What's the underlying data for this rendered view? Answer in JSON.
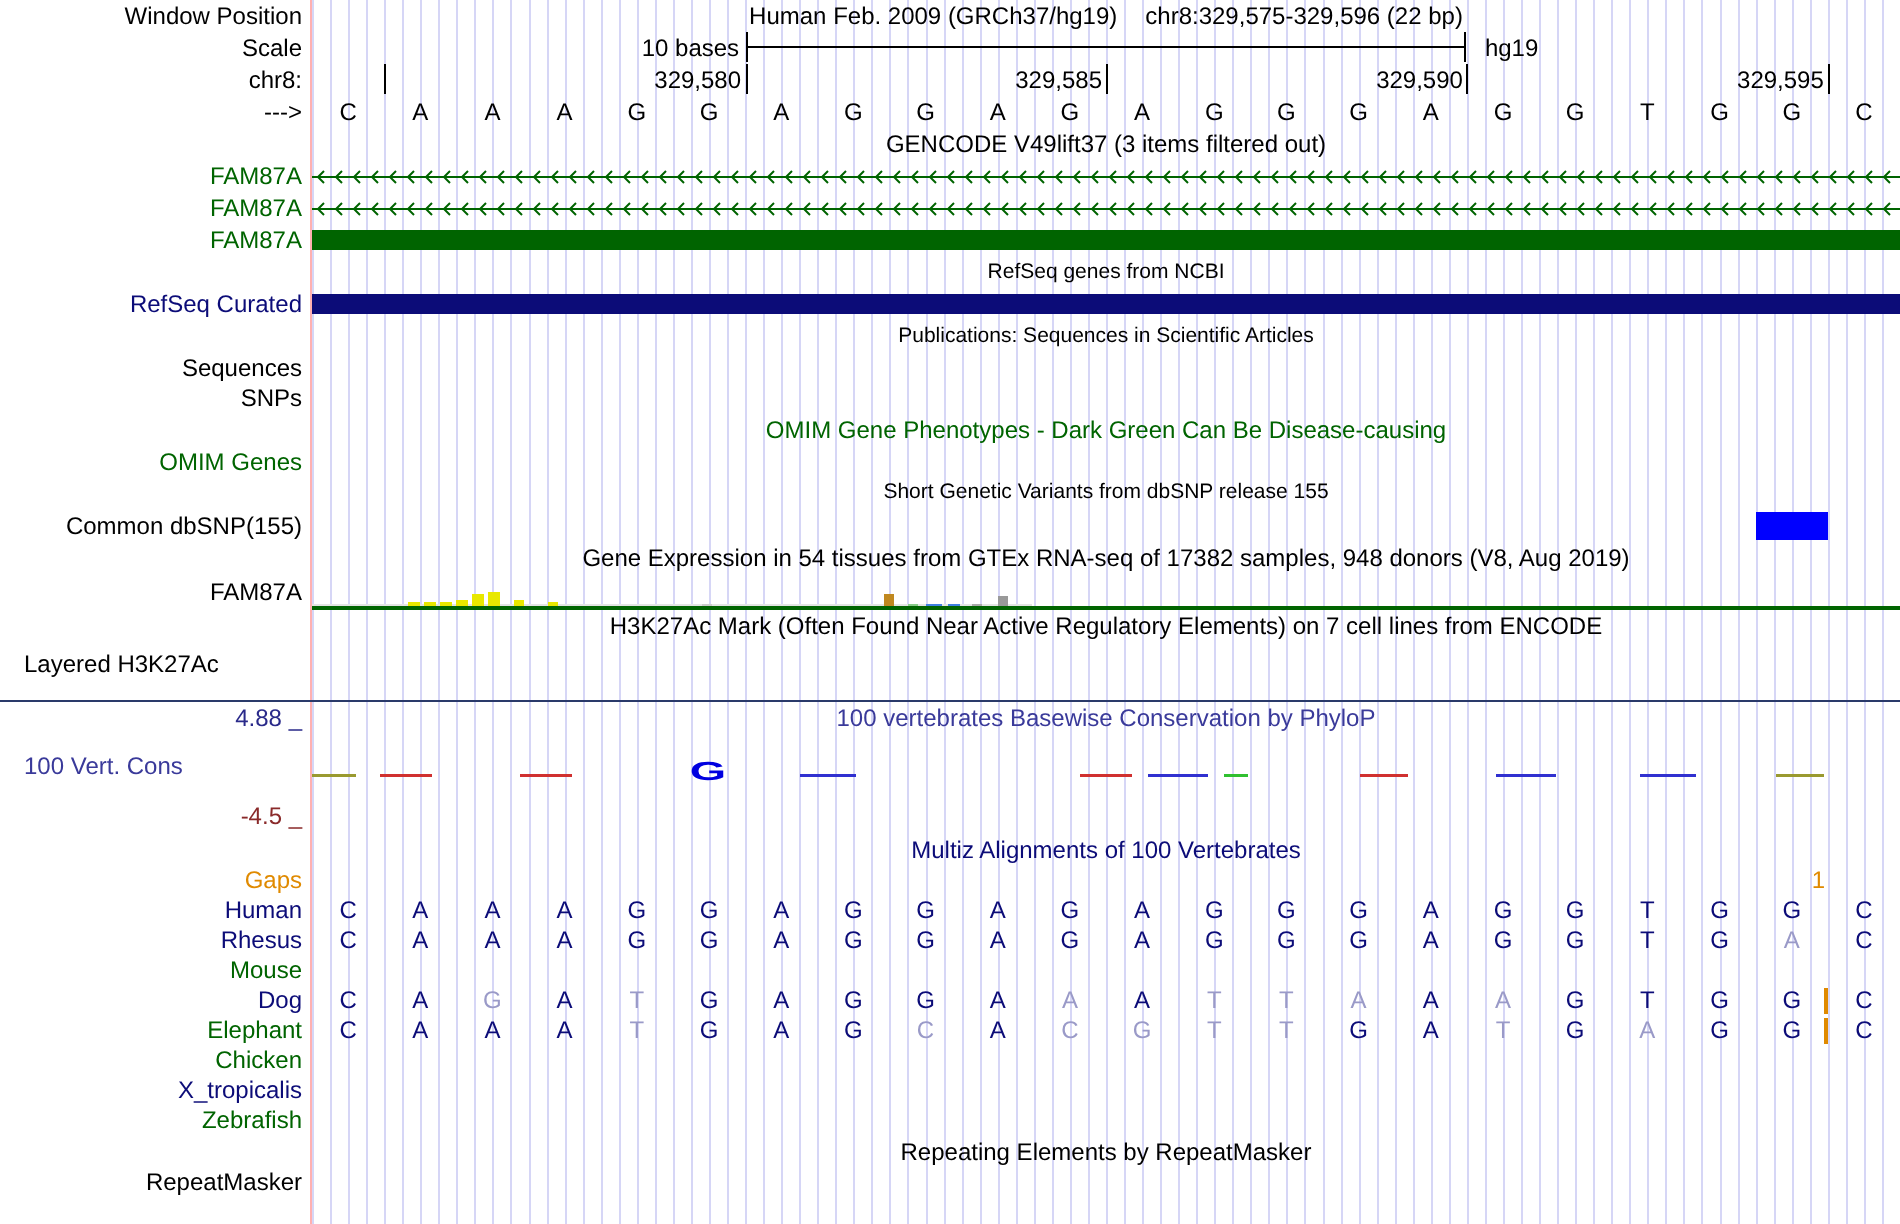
{
  "header": {
    "position_label": "Window Position",
    "assembly": "Human Feb. 2009 (GRCh37/hg19)",
    "range": "chr8:329,575-329,596 (22 bp)",
    "scale_label": "Scale",
    "scale_text": "10 bases",
    "scale_db": "hg19",
    "chrom_label": "chr8:",
    "ticks": [
      "329,580",
      "329,585",
      "329,590",
      "329,595"
    ],
    "strand_label": "--->",
    "bases": [
      "C",
      "A",
      "A",
      "A",
      "G",
      "G",
      "A",
      "G",
      "G",
      "A",
      "G",
      "A",
      "G",
      "G",
      "G",
      "A",
      "G",
      "G",
      "T",
      "G",
      "G",
      "C"
    ]
  },
  "tracks": [
    {
      "kind": "title",
      "text": "GENCODE V49lift37 (3 items filtered out)",
      "color": "#000000"
    },
    {
      "kind": "gene_arrows",
      "label": "FAM87A",
      "color": "#006400"
    },
    {
      "kind": "gene_arrows",
      "label": "FAM87A",
      "color": "#006400"
    },
    {
      "kind": "gene_block",
      "label": "FAM87A",
      "color": "#006400"
    },
    {
      "kind": "note",
      "text": "RefSeq genes from NCBI",
      "color": "#000000"
    },
    {
      "kind": "gene_block",
      "label": "RefSeq Curated",
      "color": "#0c0c78"
    },
    {
      "kind": "note",
      "text": "Publications: Sequences in Scientific Articles",
      "color": "#000000"
    },
    {
      "kind": "label",
      "label": "Sequences",
      "color": "#000000"
    },
    {
      "kind": "label",
      "label": "SNPs",
      "color": "#000000"
    },
    {
      "kind": "title",
      "text": "OMIM Gene Phenotypes - Dark Green Can Be Disease-causing",
      "color": "#006400"
    },
    {
      "kind": "label",
      "label": "OMIM Genes",
      "color": "#006400"
    },
    {
      "kind": "note",
      "text": "Short Genetic Variants from dbSNP release 155",
      "color": "#000000"
    },
    {
      "kind": "snp",
      "label": "Common dbSNP(155)",
      "color": "#000000"
    },
    {
      "kind": "title",
      "text": "Gene Expression in 54 tissues from GTEx RNA-seq of 17382 samples, 948 donors (V8, Aug 2019)",
      "color": "#000000"
    },
    {
      "kind": "expression",
      "label": "FAM87A",
      "color": "#000000"
    },
    {
      "kind": "title",
      "text": "H3K27Ac Mark (Often Found Near Active Regulatory Elements) on 7 cell lines from ENCODE",
      "color": "#000000"
    },
    {
      "kind": "layered",
      "label": "Layered H3K27Ac",
      "color": "#000000"
    },
    {
      "kind": "phylop",
      "title": "100 vertebrates Basewise Conservation by PhyloP",
      "label": "100 Vert. Cons",
      "max": "4.88 _",
      "min": "-4.5 _",
      "letter": "G",
      "color": "#3a3a9a"
    },
    {
      "kind": "title",
      "text": "Multiz Alignments of 100 Vertebrates",
      "color": "#0c0c78"
    },
    {
      "kind": "gaps",
      "label": "Gaps",
      "count": "1",
      "color": "#e08a00"
    },
    {
      "kind": "species",
      "label": "Human",
      "color": "#0c0c78",
      "bases": [
        {
          "b": "C",
          "match": true
        },
        {
          "b": "A",
          "match": true
        },
        {
          "b": "A",
          "match": true
        },
        {
          "b": "A",
          "match": true
        },
        {
          "b": "G",
          "match": true
        },
        {
          "b": "G",
          "match": true
        },
        {
          "b": "A",
          "match": true
        },
        {
          "b": "G",
          "match": true
        },
        {
          "b": "G",
          "match": true
        },
        {
          "b": "A",
          "match": true
        },
        {
          "b": "G",
          "match": true
        },
        {
          "b": "A",
          "match": true
        },
        {
          "b": "G",
          "match": true
        },
        {
          "b": "G",
          "match": true
        },
        {
          "b": "G",
          "match": true
        },
        {
          "b": "A",
          "match": true
        },
        {
          "b": "G",
          "match": true
        },
        {
          "b": "G",
          "match": true
        },
        {
          "b": "T",
          "match": true
        },
        {
          "b": "G",
          "match": true
        },
        {
          "b": "G",
          "match": true
        },
        {
          "b": "C",
          "match": true
        }
      ]
    },
    {
      "kind": "species",
      "label": "Rhesus",
      "color": "#0c0c78",
      "bases": [
        {
          "b": "C",
          "match": true
        },
        {
          "b": "A",
          "match": true
        },
        {
          "b": "A",
          "match": true
        },
        {
          "b": "A",
          "match": true
        },
        {
          "b": "G",
          "match": true
        },
        {
          "b": "G",
          "match": true
        },
        {
          "b": "A",
          "match": true
        },
        {
          "b": "G",
          "match": true
        },
        {
          "b": "G",
          "match": true
        },
        {
          "b": "A",
          "match": true
        },
        {
          "b": "G",
          "match": true
        },
        {
          "b": "A",
          "match": true
        },
        {
          "b": "G",
          "match": true
        },
        {
          "b": "G",
          "match": true
        },
        {
          "b": "G",
          "match": true
        },
        {
          "b": "A",
          "match": true
        },
        {
          "b": "G",
          "match": true
        },
        {
          "b": "G",
          "match": true
        },
        {
          "b": "T",
          "match": true
        },
        {
          "b": "G",
          "match": true
        },
        {
          "b": "A",
          "match": false
        },
        {
          "b": "C",
          "match": true
        }
      ]
    },
    {
      "kind": "species",
      "label": "Mouse",
      "color": "#006400"
    },
    {
      "kind": "species",
      "label": "Dog",
      "color": "#0c0c78",
      "bases": [
        {
          "b": "C",
          "match": true
        },
        {
          "b": "A",
          "match": true
        },
        {
          "b": "G",
          "match": false
        },
        {
          "b": "A",
          "match": true
        },
        {
          "b": "T",
          "match": false
        },
        {
          "b": "G",
          "match": true
        },
        {
          "b": "A",
          "match": true
        },
        {
          "b": "G",
          "match": true
        },
        {
          "b": "G",
          "match": true
        },
        {
          "b": "A",
          "match": true
        },
        {
          "b": "A",
          "match": false
        },
        {
          "b": "A",
          "match": true
        },
        {
          "b": "T",
          "match": false
        },
        {
          "b": "T",
          "match": false
        },
        {
          "b": "A",
          "match": false
        },
        {
          "b": "A",
          "match": true
        },
        {
          "b": "A",
          "match": false
        },
        {
          "b": "G",
          "match": true
        },
        {
          "b": "T",
          "match": true
        },
        {
          "b": "G",
          "match": true
        },
        {
          "b": "G",
          "match": true,
          "insertion": true
        },
        {
          "b": "C",
          "match": true
        }
      ]
    },
    {
      "kind": "species",
      "label": "Elephant",
      "color": "#006400",
      "bases": [
        {
          "b": "C",
          "match": true
        },
        {
          "b": "A",
          "match": true
        },
        {
          "b": "A",
          "match": true
        },
        {
          "b": "A",
          "match": true
        },
        {
          "b": "T",
          "match": false
        },
        {
          "b": "G",
          "match": true
        },
        {
          "b": "A",
          "match": true
        },
        {
          "b": "G",
          "match": true
        },
        {
          "b": "C",
          "match": false
        },
        {
          "b": "A",
          "match": true
        },
        {
          "b": "C",
          "match": false
        },
        {
          "b": "G",
          "match": false
        },
        {
          "b": "T",
          "match": false
        },
        {
          "b": "T",
          "match": false
        },
        {
          "b": "G",
          "match": true
        },
        {
          "b": "A",
          "match": true
        },
        {
          "b": "T",
          "match": false
        },
        {
          "b": "G",
          "match": true
        },
        {
          "b": "A",
          "match": false
        },
        {
          "b": "G",
          "match": true
        },
        {
          "b": "G",
          "match": true,
          "insertion": true
        },
        {
          "b": "C",
          "match": true
        }
      ]
    },
    {
      "kind": "species",
      "label": "Chicken",
      "color": "#006400"
    },
    {
      "kind": "species",
      "label": "X_tropicalis",
      "color": "#0c0c78"
    },
    {
      "kind": "species",
      "label": "Zebrafish",
      "color": "#006400"
    },
    {
      "kind": "title",
      "text": "Repeating Elements by RepeatMasker",
      "color": "#000000"
    },
    {
      "kind": "label",
      "label": "RepeatMasker",
      "color": "#000000"
    }
  ]
}
